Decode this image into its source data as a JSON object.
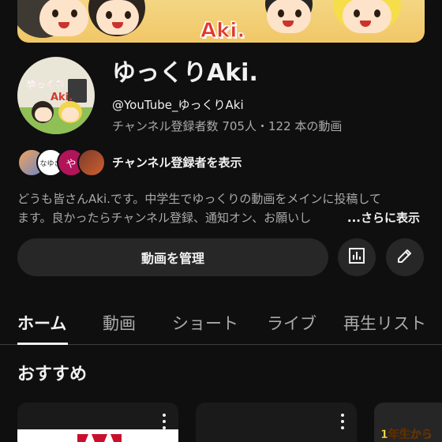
{
  "banner": {
    "text": "Aki."
  },
  "avatar": {
    "line1": "ゆっくり",
    "line2": "Aki."
  },
  "channel": {
    "name": "ゆっくりAki.",
    "handle": "@YouTube_ゆっくりAki",
    "stats": "チャンネル登録者数 705人・122 本の動画"
  },
  "subscribers": {
    "avatar2_text": "なゆき",
    "avatar3_text": "や",
    "label": "チャンネル登録者を表示"
  },
  "description": {
    "line1": "どうも皆さんAki.です。中学生でゆっくりの動画をメインに投稿して",
    "line2": "ます。良かったらチャンネル登録、通知オン、お願いし",
    "more_label": "...さらに表示"
  },
  "actions": {
    "manage_label": "動画を管理",
    "analytics_icon": "analytics-icon",
    "edit_icon": "pencil-icon"
  },
  "tabs": [
    {
      "label": "ホーム",
      "active": true
    },
    {
      "label": "動画",
      "active": false
    },
    {
      "label": "ショート",
      "active": false
    },
    {
      "label": "ライブ",
      "active": false
    },
    {
      "label": "再生リスト",
      "active": false
    }
  ],
  "section": {
    "title": "おすすめ"
  },
  "cards": {
    "card3_label": "1年生から"
  },
  "colors": {
    "background": "#0f0f0f",
    "button_bg": "#272727",
    "text_primary": "#f1f1f1",
    "text_secondary": "#aaaaaa",
    "banner_bg": "#f1c766",
    "banner_text": "#e2372c"
  }
}
